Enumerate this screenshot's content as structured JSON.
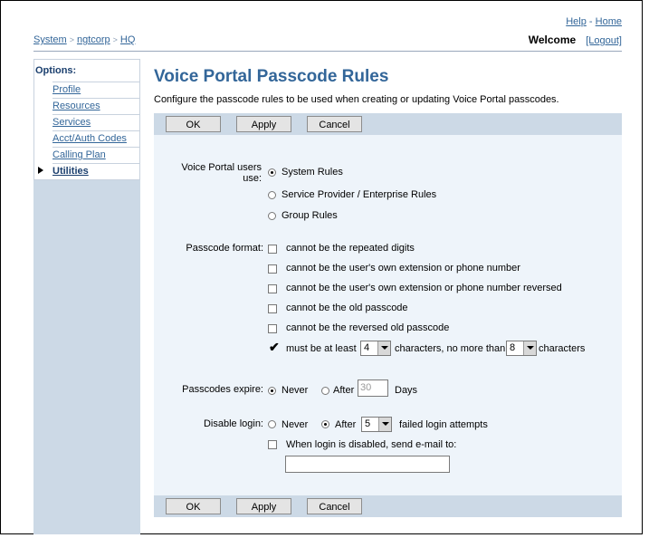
{
  "header": {
    "help": "Help",
    "sep": "-",
    "home": "Home",
    "welcome": "Welcome",
    "logout": "[Logout]"
  },
  "breadcrumb": {
    "items": [
      "System",
      "ngtcorp",
      "HQ"
    ],
    "sep": ">"
  },
  "sidebar": {
    "title": "Options:",
    "items": [
      {
        "label": "Profile"
      },
      {
        "label": "Resources"
      },
      {
        "label": "Services"
      },
      {
        "label": "Acct/Auth Codes"
      },
      {
        "label": "Calling Plan"
      },
      {
        "label": "Utilities"
      }
    ]
  },
  "main": {
    "title": "Voice Portal Passcode Rules",
    "description": "Configure the passcode rules to be used when creating or updating Voice Portal passcodes.",
    "buttons": {
      "ok": "OK",
      "apply": "Apply",
      "cancel": "Cancel"
    },
    "users_use": {
      "label1": "Voice Portal users",
      "label2": "use:",
      "options": [
        "System Rules",
        "Service Provider / Enterprise Rules",
        "Group Rules"
      ],
      "selected": "System Rules"
    },
    "format": {
      "label": "Passcode format:",
      "rules": [
        "cannot be the repeated digits",
        "cannot be the user's own extension or phone number",
        "cannot be the user's own extension or phone number reversed",
        "cannot be the old passcode",
        "cannot be the reversed old passcode"
      ],
      "length_prefix": "must be at least",
      "min": "4",
      "length_middle": "characters, no more than",
      "max": "8",
      "length_suffix": "characters"
    },
    "expire": {
      "label": "Passcodes expire:",
      "never": "Never",
      "after": "After",
      "days_value": "30",
      "days": "Days",
      "selected": "Never"
    },
    "disable": {
      "label": "Disable login:",
      "never": "Never",
      "after": "After",
      "attempts_value": "5",
      "attempts_suffix": "failed login attempts",
      "selected": "After",
      "email_label": "When login is disabled, send e-mail to:",
      "email_value": ""
    }
  },
  "colors": {
    "link": "#336699",
    "panel": "#eef4fa",
    "bar": "#ccd9e6",
    "title": "#336699"
  }
}
